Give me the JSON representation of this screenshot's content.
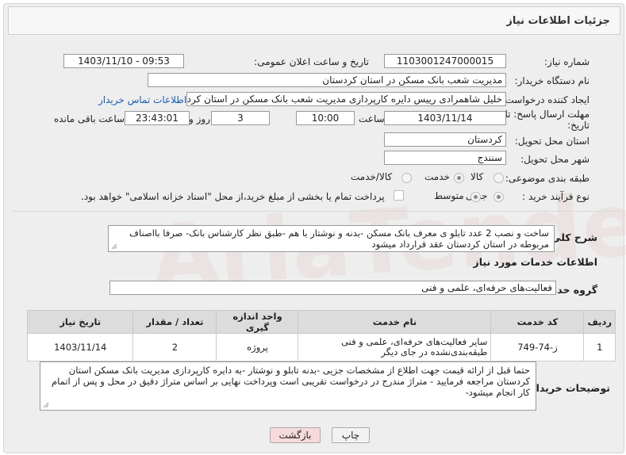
{
  "header": {
    "title": "جزئیات اطلاعات نیاز"
  },
  "fields": {
    "need_number_label": "شماره نیاز:",
    "need_number": "1103001247000015",
    "announce_label": "تاریخ و ساعت اعلان عمومی:",
    "announce_value": "1403/11/10 - 09:53",
    "buyer_label": "نام دستگاه خریدار:",
    "buyer_value": "مدیریت شعب بانک مسکن در استان کردستان",
    "creator_label": "ایجاد کننده درخواست:",
    "creator_value": "خلیل شاهمرادی رییس دایره کارپردازی مدیریت شعب بانک مسکن در استان کرد",
    "contact_link": "اطلاعات تماس خریدار",
    "deadline_label_1": "مهلت ارسال پاسخ: تا",
    "deadline_label_2": "تاریخ:",
    "deadline_date": "1403/11/14",
    "time_label": "ساعت",
    "deadline_time": "10:00",
    "days_value": "3",
    "days_label": "روز و",
    "remaining_time": "23:43:01",
    "remaining_label": "ساعت باقی مانده",
    "province_label": "استان محل تحویل:",
    "province_value": "کردستان",
    "city_label": "شهر محل تحویل:",
    "city_value": "سنندج",
    "category_label": "طبقه بندی موضوعی:",
    "category_options": [
      "کالا",
      "خدمت",
      "کالا/خدمت"
    ],
    "category_selected": "خدمت",
    "process_label": "نوع فرآیند خرید :",
    "process_options": [
      "جزیی",
      "متوسط"
    ],
    "process_selected": "جزیی",
    "payment_note": "پرداخت تمام یا بخشی از مبلغ خرید،از محل \"اسناد خزانه اسلامی\" خواهد بود."
  },
  "summary": {
    "label": "شرح کلی نیاز:",
    "text": "ساخت و نصب 2 عدد تابلو ی معرف بانک مسکن -بدنه و نوشتار با هم -طبق نظر کارشناس بانک- صرفا بااصناف مربوطه در استان کردستان عقد قرارداد میشود"
  },
  "services": {
    "section_title": "اطلاعات خدمات مورد نیاز",
    "group_label": "گروه خدمت:",
    "group_value": "فعالیت‌های حرفه‌ای، علمی و فنی",
    "columns": [
      "ردیف",
      "کد خدمت",
      "نام خدمت",
      "واحد اندازه گیری",
      "تعداد / مقدار",
      "تاریخ نیاز"
    ],
    "rows": [
      [
        "1",
        "ز-74-749",
        "سایر فعالیت‌های حرفه‌ای، علمی و فنی طبقه‌بندی‌نشده در جای دیگر",
        "پروژه",
        "2",
        "1403/11/14"
      ]
    ]
  },
  "buyer_notes": {
    "label": "توضیحات خریدار:",
    "text": "حتما قبل از ارائه قیمت جهت اطلاع از مشخصات جزیی -بدنه تابلو و نوشتار -به دایره کارپردازی مدیریت بانک مسکن استان کردستان مراجعه فرمایید - متراژ مندرج در درخواست تقریبی است وپرداخت نهایی بر اساس متراژ دقیق در محل و پس از اتمام کار انجام میشود-"
  },
  "buttons": {
    "print": "چاپ",
    "back": "بازگشت"
  },
  "watermark": "AriaTender.net",
  "colors": {
    "link": "#1a5fb4",
    "back_button_bg": "#f6dada",
    "print_button_bg": "#f2f2f2"
  }
}
